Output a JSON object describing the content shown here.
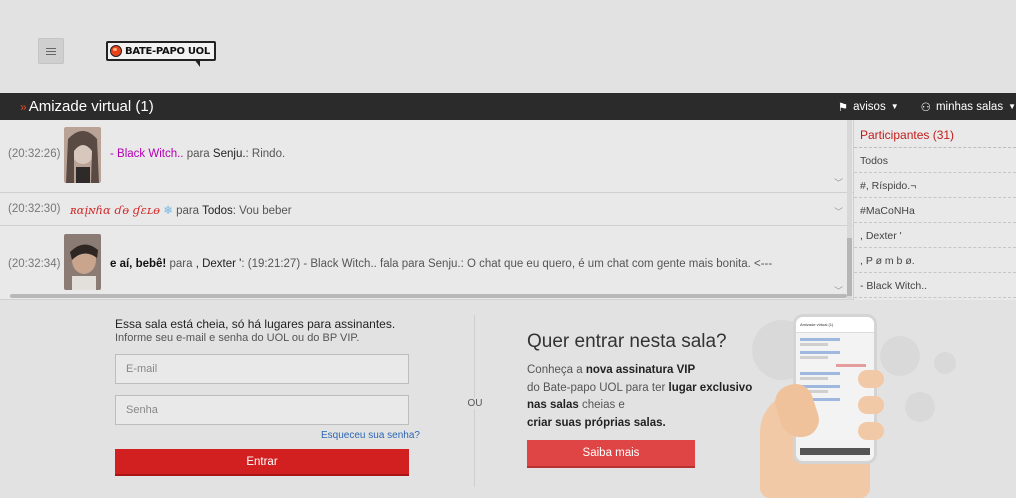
{
  "header": {
    "menu_icon": "hamburger-icon",
    "logo_text": "BATE-PAPO UOL"
  },
  "room": {
    "arrows": "»",
    "title": "Amizade virtual (1)",
    "avisos_label": "avisos",
    "minhas_salas_label": "minhas salas"
  },
  "messages": [
    {
      "time": "(20:32:26)",
      "sender": "- Black Witch..",
      "para": "para",
      "recipient": "Senju.",
      "text": ": Rindo."
    },
    {
      "time": "(20:32:30)",
      "sender": "ʀɑįɴɦɑ ɗɵ ɠɛʟɵ",
      "snow": "❄",
      "para": "para",
      "recipient": "Todos",
      "text": ": Vou beber"
    },
    {
      "time": "(20:32:34)",
      "sender": "e aí, bebê!",
      "para": "para",
      "recipient": ", Dexter '",
      "text": ": (19:21:27) - Black Witch.. fala para Senju.: O chat que eu quero, é um chat com gente mais bonita. <---"
    }
  ],
  "participants": {
    "title": "Participantes (31)",
    "items": [
      "Todos",
      "#, Ríspido.¬",
      "#MaCoNHa",
      ", Dexter '",
      ", P ø m b ø.",
      "- Black Witch.."
    ]
  },
  "login": {
    "title": "Essa sala está cheia, só há lugares para assinantes.",
    "subtitle": "Informe seu e-mail e senha do UOL ou do BP VIP.",
    "email_placeholder": "E-mail",
    "password_placeholder": "Senha",
    "forgot_link": "Esqueceu sua senha?",
    "enter_button": "Entrar",
    "or_label": "OU"
  },
  "vip": {
    "title": "Quer entrar nesta sala?",
    "text_1": "Conheça a ",
    "text_2": "nova assinatura VIP",
    "text_3": "do Bate-papo UOL para ter ",
    "text_4": "lugar exclusivo nas salas",
    "text_5": " cheias e",
    "text_6": "criar suas próprias salas.",
    "button": "Saiba mais",
    "phone_title": "Amizade virtual (1)"
  },
  "colors": {
    "accent_red": "#d21f1f",
    "room_bar": "#2b2b2b",
    "participants_title": "#c31b1b",
    "link_blue": "#2b67b3"
  }
}
